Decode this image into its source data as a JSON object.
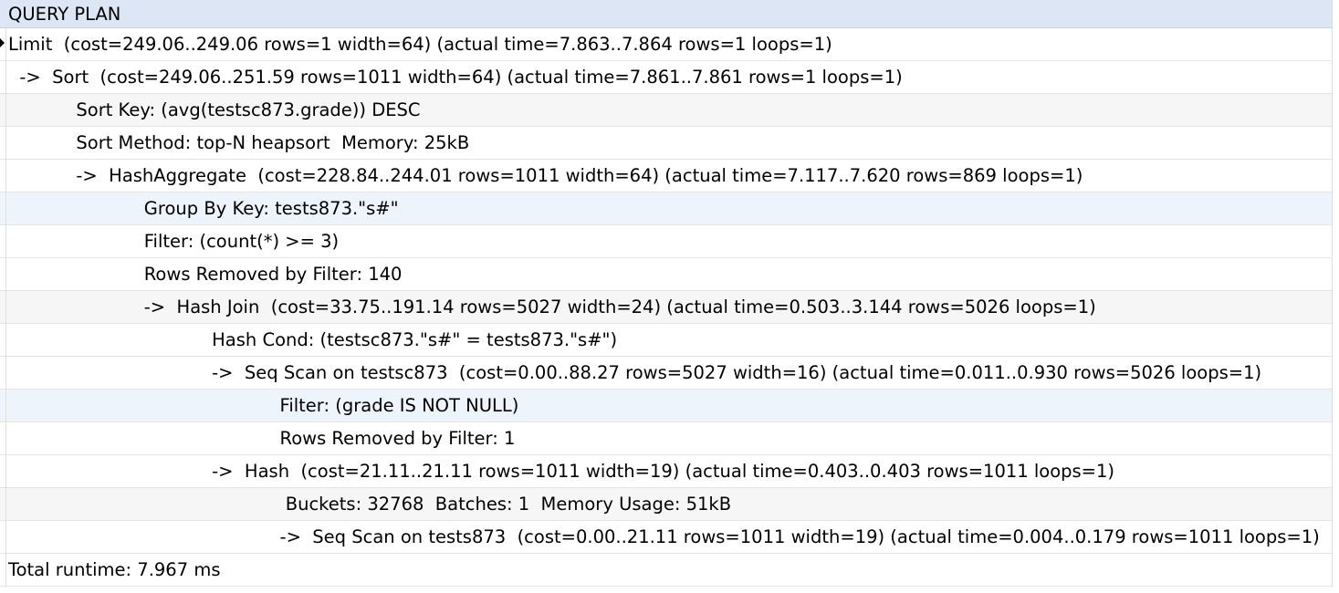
{
  "grid": {
    "column_header": "QUERY PLAN",
    "rows": [
      "Limit  (cost=249.06..249.06 rows=1 width=64) (actual time=7.863..7.864 rows=1 loops=1)",
      "  ->  Sort  (cost=249.06..251.59 rows=1011 width=64) (actual time=7.861..7.861 rows=1 loops=1)",
      "            Sort Key: (avg(testsc873.grade)) DESC",
      "            Sort Method: top-N heapsort  Memory: 25kB",
      "            ->  HashAggregate  (cost=228.84..244.01 rows=1011 width=64) (actual time=7.117..7.620 rows=869 loops=1)",
      "                        Group By Key: tests873.\"s#\"",
      "                        Filter: (count(*) >= 3)",
      "                        Rows Removed by Filter: 140",
      "                        ->  Hash Join  (cost=33.75..191.14 rows=5027 width=24) (actual time=0.503..3.144 rows=5026 loops=1)",
      "                                    Hash Cond: (testsc873.\"s#\" = tests873.\"s#\")",
      "                                    ->  Seq Scan on testsc873  (cost=0.00..88.27 rows=5027 width=16) (actual time=0.011..0.930 rows=5026 loops=1)",
      "                                                Filter: (grade IS NOT NULL)",
      "                                                Rows Removed by Filter: 1",
      "                                    ->  Hash  (cost=21.11..21.11 rows=1011 width=19) (actual time=0.403..0.403 rows=1011 loops=1)",
      "                                                 Buckets: 32768  Batches: 1  Memory Usage: 51kB",
      "                                                ->  Seq Scan on tests873  (cost=0.00..21.11 rows=1011 width=19) (actual time=0.004..0.179 rows=1011 loops=1)",
      "Total runtime: 7.967 ms"
    ]
  }
}
